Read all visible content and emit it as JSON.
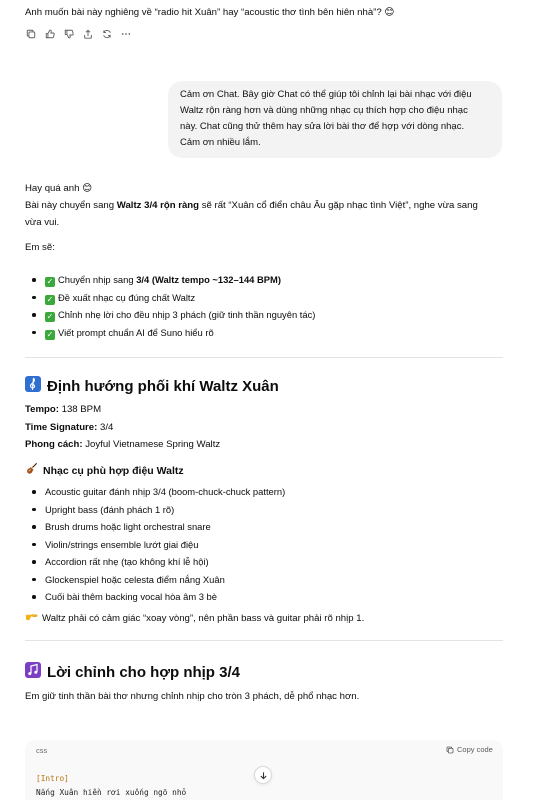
{
  "top_message": "Anh muốn bài này nghiêng về “radio hit Xuân” hay “acoustic thơ tình bên hiên nhà”? 😊",
  "user_bubble": {
    "lines": [
      "Cảm ơn Chat. Bây giờ Chat có thể giúp tôi chỉnh lại bài nhạc với điệu",
      "Waltz rộn ràng hơn và dùng những nhạc cụ thích hợp cho điệu nhạc",
      "này. Chat cũng thử thêm hay sửa lời bài thơ để hợp với dòng nhạc.",
      "Cảm ơn nhiều lắm."
    ]
  },
  "reply": {
    "greeting": "Hay quá anh 😊",
    "intro_pre": "Bài này chuyển sang ",
    "intro_bold": "Waltz 3/4 rộn ràng",
    "intro_post_1": " sẽ rất “Xuân cổ điển châu Âu gặp nhạc tình Việt”, nghe vừa sang",
    "intro_post_2": "vừa vui.",
    "em_se": "Em sẽ:",
    "checklist": [
      {
        "pre": "Chuyển nhịp sang ",
        "bold": "3/4 (Waltz tempo ~132–144 BPM)",
        "post": ""
      },
      {
        "pre": "Đề xuất nhạc cụ đúng chất Waltz",
        "bold": "",
        "post": ""
      },
      {
        "pre": "Chỉnh nhẹ lời cho đều nhịp 3 phách (giữ tinh thần nguyên tác)",
        "bold": "",
        "post": ""
      },
      {
        "pre": "Viết prompt chuẩn AI để Suno hiểu rõ",
        "bold": "",
        "post": ""
      }
    ]
  },
  "section1": {
    "title": "Định hướng phối khí Waltz Xuân",
    "tempo_label": "Tempo:",
    "tempo_value": " 138 BPM",
    "ts_label": "Time Signature:",
    "ts_value": " 3/4",
    "style_label": "Phong cách:",
    "style_value": " Joyful Vietnamese Spring Waltz",
    "instruments_title": "Nhạc cụ phù hợp điệu Waltz",
    "instruments": [
      "Acoustic guitar đánh nhịp 3/4 (boom-chuck-chuck pattern)",
      "Upright bass (đánh phách 1 rõ)",
      "Brush drums hoặc light orchestral snare",
      "Violin/strings ensemble lướt giai điệu",
      "Accordion rất nhẹ (tạo không khí lễ hội)",
      "Glockenspiel hoặc celesta điểm nắng Xuân",
      "Cuối bài thêm backing vocal hòa âm 3 bè"
    ],
    "note": "Waltz phải có cảm giác “xoay vòng”, nên phần bass và guitar phải rõ nhịp 1."
  },
  "section2": {
    "title": "Lời chỉnh cho hợp nhịp 3/4",
    "desc": "Em giữ tinh thần bài thơ nhưng chỉnh nhịp cho tròn 3 phách, dễ phổ nhạc hơn.",
    "code_lang": "css",
    "copy_label": "Copy code",
    "code_lines": [
      "[Intro]",
      "Nắng Xuân hiền rơi xuống ngõ nhỏ"
    ]
  },
  "colors": {
    "check": "#3aa83a",
    "bubble_bg": "#f3f3f3",
    "code_tag": "#b2730b",
    "clef_bg": "#2f6fd1",
    "music_note": "#7b3fc4",
    "violin": "#a0521d",
    "pointing_hand": "#f2b21b"
  },
  "icons": {
    "actions": [
      "copy-icon",
      "thumbs-up-icon",
      "thumbs-down-icon",
      "share-icon",
      "regenerate-icon",
      "more-icon"
    ],
    "section1": "music-clef-icon",
    "instruments": "violin-icon",
    "note": "pointing-hand-icon",
    "section2": "music-notes-icon",
    "copy": "copy-icon",
    "scroll": "arrow-down-icon"
  }
}
